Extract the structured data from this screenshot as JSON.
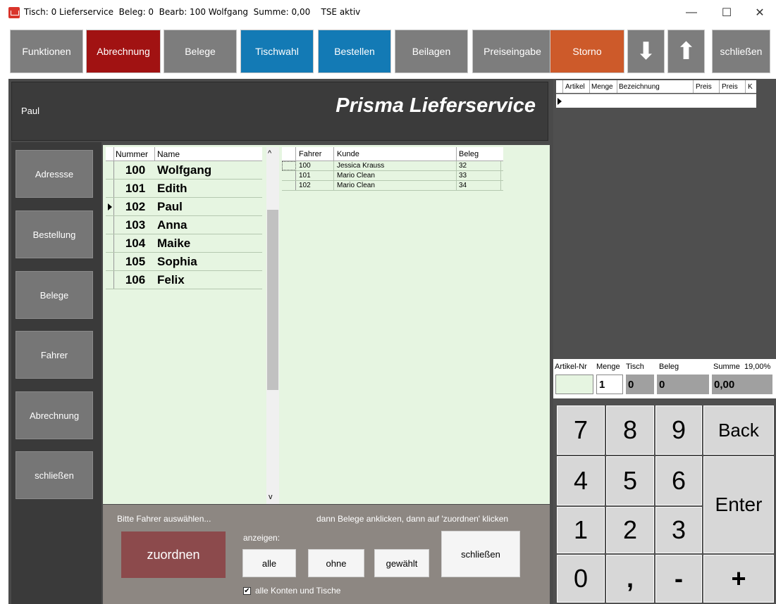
{
  "window": {
    "title": "Tisch: 0 Lieferservice  Beleg: 0  Bearb: 100 Wolfgang  Summe: 0,00    TSE aktiv",
    "minimize": "—",
    "maximize": "☐",
    "close": "✕"
  },
  "toolbar": {
    "funktionen": "Funktionen",
    "abrechnung": "Abrechnung",
    "belege": "Belege",
    "tischwahl": "Tischwahl",
    "bestellen": "Bestellen",
    "beilagen": "Beilagen",
    "preiseingabe": "Preiseingabe",
    "storno": "Storno",
    "down": "⬇",
    "up": "⬆",
    "schliessen": "schließen"
  },
  "header": {
    "user": "Paul",
    "brand": "Prisma Lieferservice"
  },
  "sidebar": {
    "items": [
      "Adressse",
      "Bestellung",
      "Belege",
      "Fahrer",
      "Abrechnung",
      "schließen"
    ]
  },
  "drivers": {
    "columns": [
      "Nummer",
      "Name"
    ],
    "selected_index": 2,
    "rows": [
      {
        "nummer": "100",
        "name": "Wolfgang"
      },
      {
        "nummer": "101",
        "name": "Edith"
      },
      {
        "nummer": "102",
        "name": "Paul"
      },
      {
        "nummer": "103",
        "name": "Anna"
      },
      {
        "nummer": "104",
        "name": "Maike"
      },
      {
        "nummer": "105",
        "name": "Sophia"
      },
      {
        "nummer": "106",
        "name": "Felix"
      }
    ],
    "scroll_up": "^",
    "scroll_down": "v"
  },
  "receipts": {
    "columns": [
      "Fahrer",
      "Kunde",
      "Beleg"
    ],
    "rows": [
      {
        "fahrer": "100",
        "kunde": "Jessica Krauss",
        "beleg": "32"
      },
      {
        "fahrer": "101",
        "kunde": "Mario Clean",
        "beleg": "33"
      },
      {
        "fahrer": "102",
        "kunde": "Mario Clean",
        "beleg": "34"
      }
    ]
  },
  "bottom": {
    "hint_left": "Bitte Fahrer auswählen...",
    "hint_right": "dann Belege anklicken, dann auf 'zuordnen' klicken",
    "zuordnen": "zuordnen",
    "anzeigen": "anzeigen:",
    "alle": "alle",
    "ohne": "ohne",
    "gewaehlt": "gewählt",
    "schliessen": "schließen",
    "checkbox_label": "alle Konten und Tische",
    "checkbox_checked": true
  },
  "order_grid": {
    "columns": [
      "Artikel",
      "Menge",
      "Bezeichnung",
      "Preis",
      "Preis",
      "K"
    ]
  },
  "info": {
    "labels": [
      "Artikel-Nr",
      "Menge",
      "Tisch",
      "Beleg",
      "Summe",
      "19,00%"
    ],
    "artikel_nr": "",
    "menge": "1",
    "tisch": "0",
    "beleg": "0",
    "summe": "0,00"
  },
  "keypad": {
    "k7": "7",
    "k8": "8",
    "k9": "9",
    "back": "Back",
    "k4": "4",
    "k5": "5",
    "k6": "6",
    "enter": "Enter",
    "k1": "1",
    "k2": "2",
    "k3": "3",
    "k0": "0",
    "comma": ",",
    "minus": "-",
    "plus": "+"
  },
  "colors": {
    "toolbar_gray": "#7d7d7d",
    "toolbar_red": "#a11212",
    "toolbar_blue": "#137ab5",
    "toolbar_orange": "#cd5a2a",
    "content_bg": "#e6f5e1"
  }
}
